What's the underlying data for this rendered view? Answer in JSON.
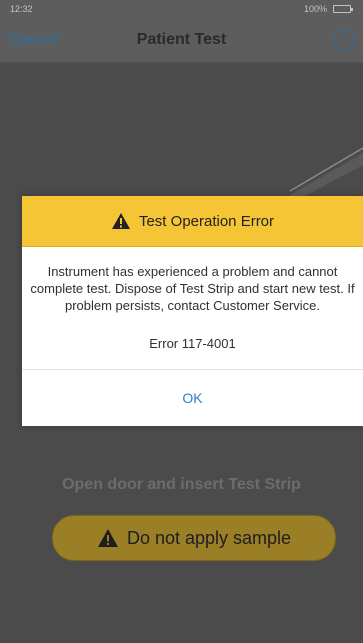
{
  "status_bar": {
    "time": "12:32",
    "battery": "100%"
  },
  "nav": {
    "cancel_label": "Cancel",
    "title": "Patient Test",
    "info_icon": "info-icon"
  },
  "alert": {
    "title": "Test Operation Error",
    "icon": "warning-icon",
    "message": "Instrument has experienced a problem and cannot complete test. Dispose of Test Strip and start new test. If problem persists, contact Customer Service.",
    "error_code": "Error 117-4001",
    "ok_label": "OK",
    "header_color": "#f6c535"
  },
  "instruction": "Open door and insert Test Strip",
  "warning_pill": {
    "label": "Do not apply sample",
    "icon": "warning-icon"
  },
  "colors": {
    "accent": "#2e80c4",
    "overlay": "#4b4b4b"
  }
}
